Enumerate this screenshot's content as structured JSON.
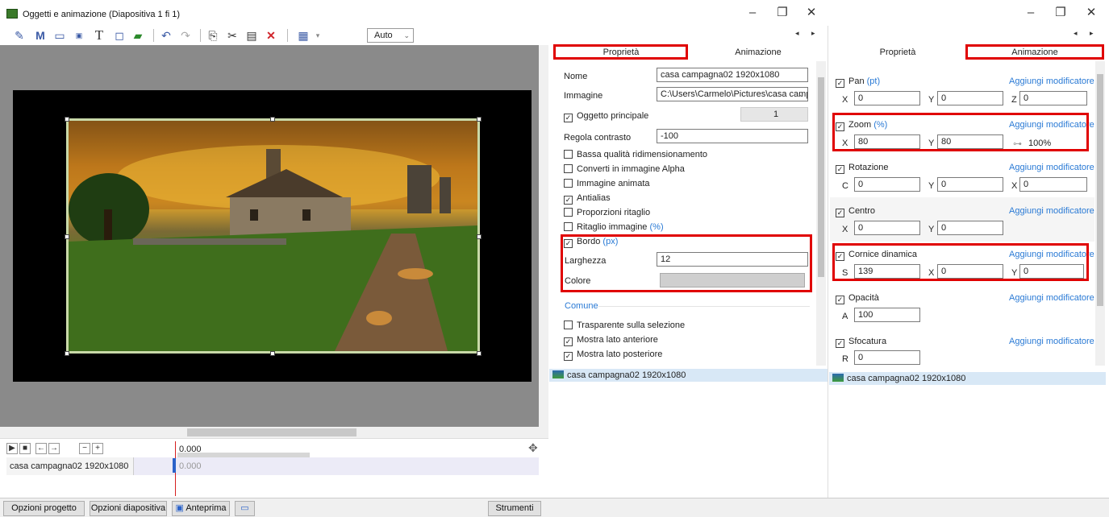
{
  "window": {
    "title": "Oggetti e animazione (Diapositiva 1 fi 1)",
    "minimize": "–",
    "maximize": "❐",
    "close": "✕"
  },
  "toolbar": {
    "zoom_value": "Auto",
    "icons": [
      "pen-icon",
      "text-m-icon",
      "rectangle-icon",
      "frame-icon",
      "text-t-icon",
      "box-icon",
      "image-icon",
      "undo-icon",
      "redo-icon",
      "copy-icon",
      "cut-icon",
      "paste-icon",
      "delete-icon",
      "grid-icon"
    ]
  },
  "left_nav": {
    "prev": "◂",
    "next": "▸"
  },
  "timeline": {
    "time_label": "0.000",
    "track_name": "casa campagna02 1920x1080",
    "track_time": "0.000",
    "controls": [
      "▶",
      "■",
      "←",
      "→",
      "−",
      "+"
    ]
  },
  "bottom": {
    "project_options": "Opzioni progetto",
    "slide_options": "Opzioni diapositiva",
    "preview": "Anteprima",
    "tools": "Strumenti"
  },
  "properties": {
    "tab_props": "Proprietà",
    "tab_anim": "Animazione",
    "name_label": "Nome",
    "name_value": "casa campagna02 1920x1080",
    "image_label": "Immagine",
    "image_value": "C:\\Users\\Carmelo\\Pictures\\casa campa",
    "main_object": "Oggetto principale",
    "main_object_value": "1",
    "contrast_label": "Regola contrasto",
    "contrast_value": "-100",
    "checks": [
      {
        "label": "Bassa qualità ridimensionamento",
        "checked": false
      },
      {
        "label": "Converti in immagine Alpha",
        "checked": false
      },
      {
        "label": "Immagine animata",
        "checked": false
      },
      {
        "label": "Antialias",
        "checked": true
      },
      {
        "label": "Proporzioni ritaglio",
        "checked": false
      }
    ],
    "crop_label": "Ritaglio immagine",
    "crop_unit": "(%)",
    "border_label": "Bordo",
    "border_unit": "(px)",
    "width_label": "Larghezza",
    "width_value": "12",
    "color_label": "Colore",
    "common_label": "Comune",
    "common_checks": [
      {
        "label": "Trasparente sulla selezione",
        "checked": false
      },
      {
        "label": "Mostra lato anteriore",
        "checked": true
      },
      {
        "label": "Mostra lato posteriore",
        "checked": true
      }
    ],
    "list_item": "casa campagna02 1920x1080"
  },
  "animation": {
    "tab_props": "Proprietà",
    "tab_anim": "Animazione",
    "modifier": "Aggiungi modificatore",
    "pan": {
      "label": "Pan",
      "unit": "(pt)",
      "x": "0",
      "y": "0",
      "z": "0"
    },
    "zoom": {
      "label": "Zoom",
      "unit": "(%)",
      "x": "80",
      "y": "80",
      "link": "100%"
    },
    "rotation": {
      "label": "Rotazione",
      "c": "0",
      "y": "0",
      "x": "0"
    },
    "center": {
      "label": "Centro",
      "x": "0",
      "y": "0"
    },
    "frame": {
      "label": "Cornice dinamica",
      "s": "139",
      "x": "0",
      "y": "0"
    },
    "opacity": {
      "label": "Opacità",
      "a": "100"
    },
    "blur": {
      "label": "Sfocatura",
      "r": "0"
    },
    "list_item": "casa campagna02 1920x1080"
  }
}
